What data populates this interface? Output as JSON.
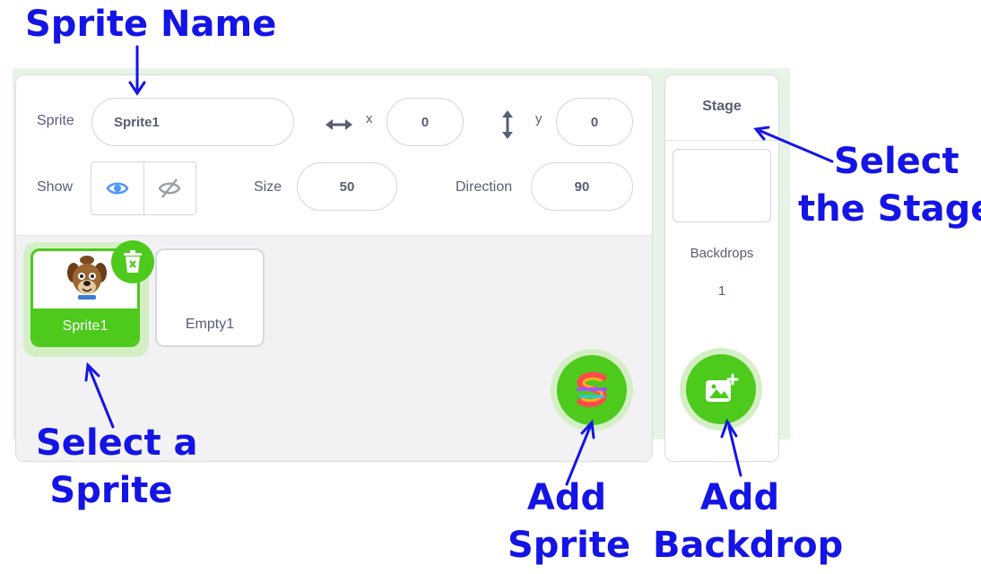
{
  "sprite_info": {
    "sprite_label": "Sprite",
    "sprite_name": "Sprite1",
    "x_label": "x",
    "x_value": "0",
    "y_label": "y",
    "y_value": "0",
    "show_label": "Show",
    "size_label": "Size",
    "size_value": "50",
    "direction_label": "Direction",
    "direction_value": "90"
  },
  "sprites": [
    {
      "name": "Sprite1",
      "selected": true
    },
    {
      "name": "Empty1",
      "selected": false
    }
  ],
  "stage": {
    "title": "Stage",
    "backdrops_label": "Backdrops",
    "backdrops_count": "1"
  },
  "colors": {
    "accent_green": "#4dca1c",
    "annotation_blue": "#1414e6",
    "text_gray": "#575e75",
    "show_active_blue": "#4c97ff"
  },
  "annotations": {
    "sprite_name": "Sprite Name",
    "select_stage_line1": "Select",
    "select_stage_line2": "the Stage",
    "select_sprite_line1": "Select a",
    "select_sprite_line2": "Sprite",
    "add_sprite_line1": "Add",
    "add_sprite_line2": "Sprite",
    "add_backdrop_line1": "Add",
    "add_backdrop_line2": "Backdrop"
  },
  "icons": {
    "x_axis": "horizontal-arrows-icon",
    "y_axis": "vertical-arrows-icon",
    "show": "eye-icon",
    "hide": "eye-slash-icon",
    "delete": "trash-icon",
    "add_sprite": "sprite-swirl-icon",
    "add_backdrop": "image-plus-icon"
  }
}
